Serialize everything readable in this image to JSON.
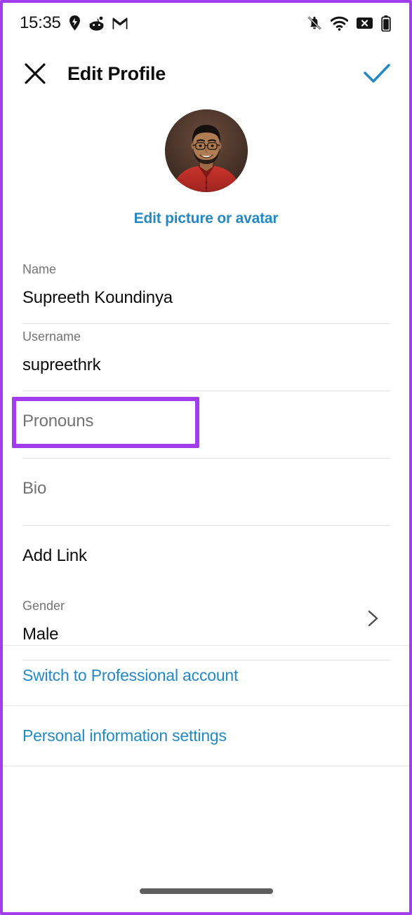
{
  "status_bar": {
    "time": "15:35",
    "left_icons": [
      {
        "name": "location-pin-icon",
        "label": "Swiggy location notification"
      },
      {
        "name": "reddit-icon",
        "label": "Reddit notification"
      },
      {
        "name": "gmail-icon",
        "label": "Gmail notification"
      }
    ],
    "right_icons": [
      {
        "name": "bell-off-icon",
        "label": "Silent mode"
      },
      {
        "name": "wifi-icon",
        "label": "Wi-Fi connected"
      },
      {
        "name": "no-sim-icon",
        "label": "No SIM"
      },
      {
        "name": "battery-icon",
        "label": "Battery"
      }
    ]
  },
  "header": {
    "close_label": "Close",
    "title": "Edit Profile",
    "confirm_label": "Done",
    "accent_color": "#2388c4"
  },
  "profile": {
    "avatar_alt": "Profile photo",
    "edit_picture_label": "Edit picture or avatar"
  },
  "form": {
    "fields": [
      {
        "key": "name",
        "label": "Name",
        "value": "Supreeth Koundinya",
        "placeholder": "",
        "type": "text"
      },
      {
        "key": "username",
        "label": "Username",
        "value": "supreethrk",
        "placeholder": "",
        "type": "text"
      },
      {
        "key": "pronouns",
        "label": "",
        "value": "",
        "placeholder": "Pronouns",
        "type": "text",
        "highlighted": true
      },
      {
        "key": "bio",
        "label": "",
        "value": "",
        "placeholder": "Bio",
        "type": "text"
      },
      {
        "key": "add_link",
        "label": "",
        "value": "Add Link",
        "placeholder": "",
        "type": "action"
      },
      {
        "key": "gender",
        "label": "Gender",
        "value": "Male",
        "placeholder": "",
        "type": "navigation"
      }
    ]
  },
  "links": [
    {
      "key": "switch_professional",
      "label": "Switch to Professional account"
    },
    {
      "key": "personal_information",
      "label": "Personal information settings"
    }
  ],
  "colors": {
    "highlight_border": "#a33ced",
    "link_blue": "#2388c4",
    "placeholder_gray": "#737373",
    "text_black": "#0d0d0d",
    "divider": "#e2e2e2"
  },
  "system": {
    "gesture_bar": "home-indicator"
  }
}
